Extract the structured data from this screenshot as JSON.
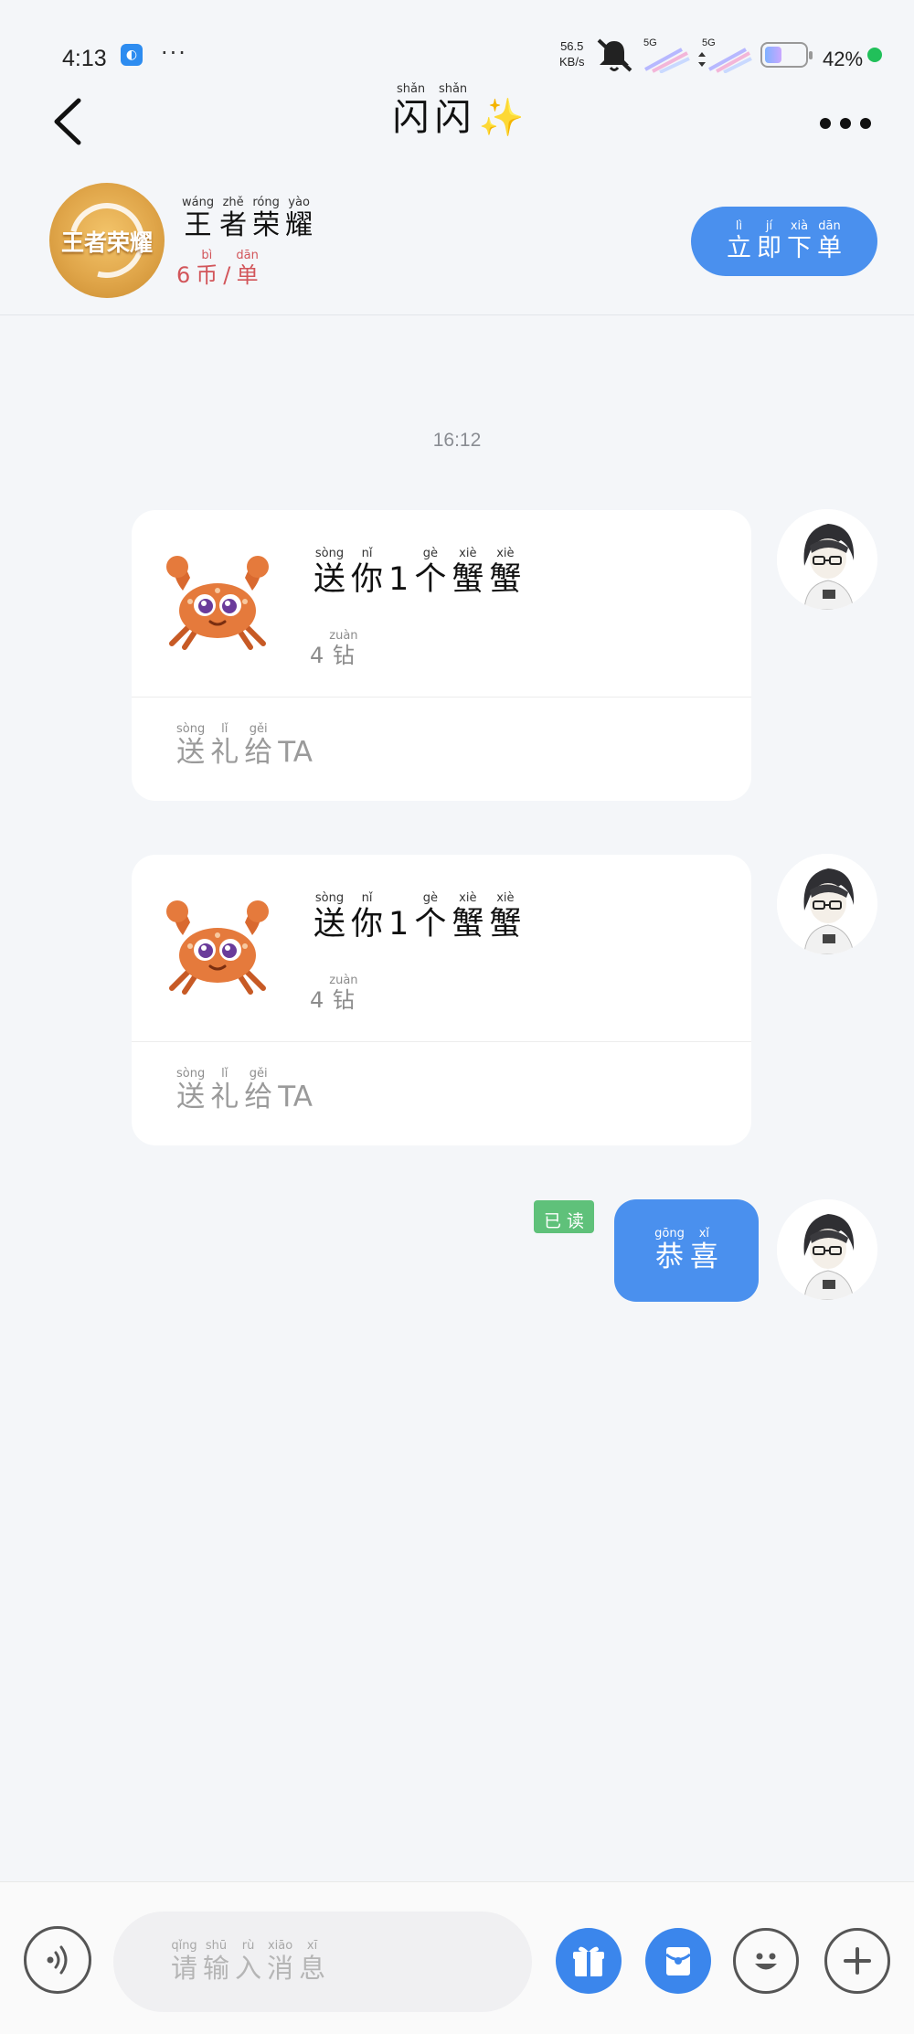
{
  "status_bar": {
    "time": "4:13",
    "more": "···",
    "speed_value": "56.5",
    "speed_unit": "KB/s",
    "signal_1": "5G",
    "signal_2": "5G",
    "battery_level_pct": 42,
    "battery_text": "42%"
  },
  "header": {
    "title_chars": [
      {
        "py": "shǎn",
        "hz": "闪"
      },
      {
        "py": "shǎn",
        "hz": "闪"
      }
    ],
    "title_emoji": "✨"
  },
  "product": {
    "logo_text": "王者荣耀",
    "name_chars": [
      {
        "py": "wáng",
        "hz": "王"
      },
      {
        "py": "zhě",
        "hz": "者"
      },
      {
        "py": "róng",
        "hz": "荣"
      },
      {
        "py": "yào",
        "hz": "耀"
      }
    ],
    "price_chars": [
      {
        "py": "",
        "hz": "6"
      },
      {
        "py": "bì",
        "hz": "币"
      },
      {
        "py": "",
        "hz": "/"
      },
      {
        "py": "dān",
        "hz": "单"
      }
    ],
    "order_button_chars": [
      {
        "py": "lì",
        "hz": "立"
      },
      {
        "py": "jí",
        "hz": "即"
      },
      {
        "py": "xià",
        "hz": "下"
      },
      {
        "py": "dān",
        "hz": "单"
      }
    ]
  },
  "chat": {
    "timestamp": "16:12",
    "gift_messages": [
      {
        "title_chars": [
          {
            "py": "sòng",
            "hz": "送"
          },
          {
            "py": "nǐ",
            "hz": "你"
          },
          {
            "py": "",
            "hz": "1"
          },
          {
            "py": "gè",
            "hz": "个"
          },
          {
            "py": "xiè",
            "hz": "蟹"
          },
          {
            "py": "xiè",
            "hz": "蟹"
          }
        ],
        "price_chars": [
          {
            "py": "",
            "hz": "4"
          },
          {
            "py": "zuàn",
            "hz": "钻"
          }
        ],
        "action_chars": [
          {
            "py": "sòng",
            "hz": "送"
          },
          {
            "py": "lǐ",
            "hz": "礼"
          },
          {
            "py": "gěi",
            "hz": "给"
          },
          {
            "py": "",
            "hz": "TA"
          }
        ]
      },
      {
        "title_chars": [
          {
            "py": "sòng",
            "hz": "送"
          },
          {
            "py": "nǐ",
            "hz": "你"
          },
          {
            "py": "",
            "hz": "1"
          },
          {
            "py": "gè",
            "hz": "个"
          },
          {
            "py": "xiè",
            "hz": "蟹"
          },
          {
            "py": "xiè",
            "hz": "蟹"
          }
        ],
        "price_chars": [
          {
            "py": "",
            "hz": "4"
          },
          {
            "py": "zuàn",
            "hz": "钻"
          }
        ],
        "action_chars": [
          {
            "py": "sòng",
            "hz": "送"
          },
          {
            "py": "lǐ",
            "hz": "礼"
          },
          {
            "py": "gěi",
            "hz": "给"
          },
          {
            "py": "",
            "hz": "TA"
          }
        ]
      }
    ],
    "read_badge_chars": [
      {
        "py": "",
        "hz": "已"
      },
      {
        "py": "",
        "hz": "读"
      }
    ],
    "text_message_chars": [
      {
        "py": "gōng",
        "hz": "恭"
      },
      {
        "py": "xǐ",
        "hz": "喜"
      }
    ]
  },
  "composer": {
    "placeholder_chars": [
      {
        "py": "qǐng",
        "hz": "请"
      },
      {
        "py": "shū",
        "hz": "输"
      },
      {
        "py": "rù",
        "hz": "入"
      },
      {
        "py": "xiāo",
        "hz": "消"
      },
      {
        "py": "xī",
        "hz": "息"
      }
    ]
  },
  "icons": {
    "back": "chevron-left-icon",
    "more": "more-horizontal-icon",
    "voice": "voice-icon",
    "gift": "gift-icon",
    "red_packet": "red-packet-icon",
    "emoji": "smile-icon",
    "plus": "plus-icon"
  },
  "colors": {
    "accent_blue": "#4a90ee",
    "price_red": "#d2555a",
    "read_green": "#5fc17a",
    "background": "#f4f6f9"
  }
}
